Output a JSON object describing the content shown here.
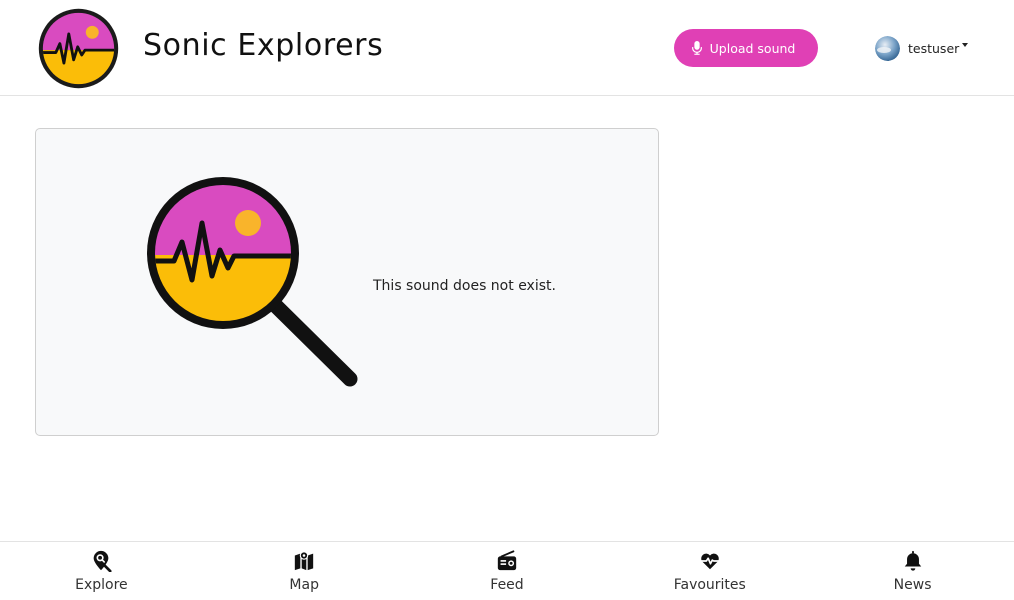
{
  "header": {
    "site_title": "Sonic Explorers",
    "upload_label": "Upload sound",
    "username": "testuser"
  },
  "colors": {
    "accent": "#e040b5",
    "logo_magenta": "#d94bc0",
    "logo_yellow": "#fbbd08",
    "logo_sun": "#f9b42b"
  },
  "main": {
    "message": "This sound does not exist."
  },
  "bottom_nav": {
    "items": [
      {
        "label": "Explore",
        "icon": "map-pin-search-icon"
      },
      {
        "label": "Map",
        "icon": "map-icon"
      },
      {
        "label": "Feed",
        "icon": "radio-icon"
      },
      {
        "label": "Favourites",
        "icon": "heart-pulse-icon"
      },
      {
        "label": "News",
        "icon": "bell-icon"
      }
    ]
  }
}
